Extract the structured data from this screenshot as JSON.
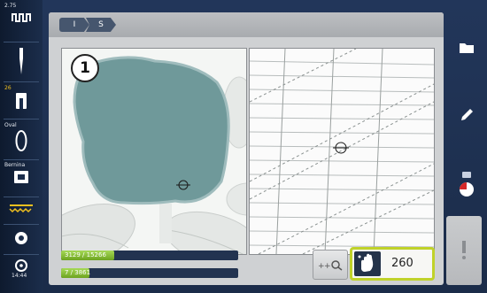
{
  "sidebar": {
    "top_label": "2.75",
    "presser_foot_number": "26",
    "hoop_label": "Oval",
    "mode_label": "Bernina",
    "time": "14:44"
  },
  "breadcrumb": {
    "items": [
      "I",
      "S"
    ]
  },
  "pane": {
    "callout_number": "1"
  },
  "progress": {
    "top": {
      "text": "3129 / 15266",
      "fraction": 0.3
    },
    "bottom": {
      "text": "7 / 3861",
      "fraction": 0.16
    }
  },
  "stitch_counter": {
    "value": "260"
  },
  "colors": {
    "accent_green": "#8ec63f",
    "highlight_border": "#c0d22a",
    "design_fill": "#6f999a"
  }
}
